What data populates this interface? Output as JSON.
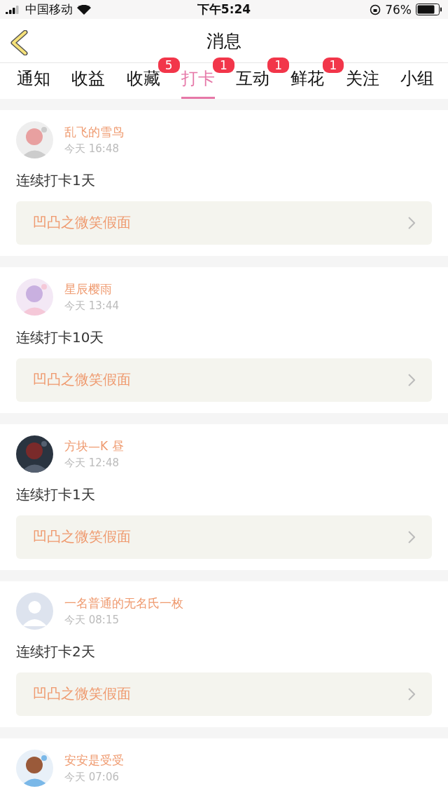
{
  "status_bar": {
    "carrier": "中国移动",
    "time": "下午5:24",
    "battery": "76%"
  },
  "nav": {
    "title": "消息"
  },
  "tabs": [
    {
      "label": "通知",
      "selected": false
    },
    {
      "label": "收益",
      "selected": false
    },
    {
      "label": "收藏",
      "selected": false,
      "badge": "5"
    },
    {
      "label": "打卡",
      "selected": true,
      "badge": "1"
    },
    {
      "label": "互动",
      "selected": false,
      "badge": "1"
    },
    {
      "label": "鲜花",
      "selected": false,
      "badge": "1"
    },
    {
      "label": "关注",
      "selected": false
    },
    {
      "label": "小组",
      "selected": false
    }
  ],
  "messages": [
    {
      "user": "乱飞的雪鸟",
      "time": "今天 16:48",
      "kind": "picture",
      "text": "连续打卡1天",
      "link": "凹凸之微笑假面"
    },
    {
      "user": "星辰樱雨",
      "time": "今天 13:44",
      "kind": "picture",
      "text": "连续打卡10天",
      "link": "凹凸之微笑假面"
    },
    {
      "user": "方块—K 昼",
      "time": "今天 12:48",
      "kind": "picture",
      "text": "连续打卡1天",
      "link": "凹凸之微笑假面"
    },
    {
      "user": "一名普通的无名氏一枚",
      "time": "今天 08:15",
      "kind": "default",
      "text": "连续打卡2天",
      "link": "凹凸之微笑假面"
    },
    {
      "user": "安安是受受",
      "time": "今天 07:06",
      "kind": "picture"
    }
  ]
}
